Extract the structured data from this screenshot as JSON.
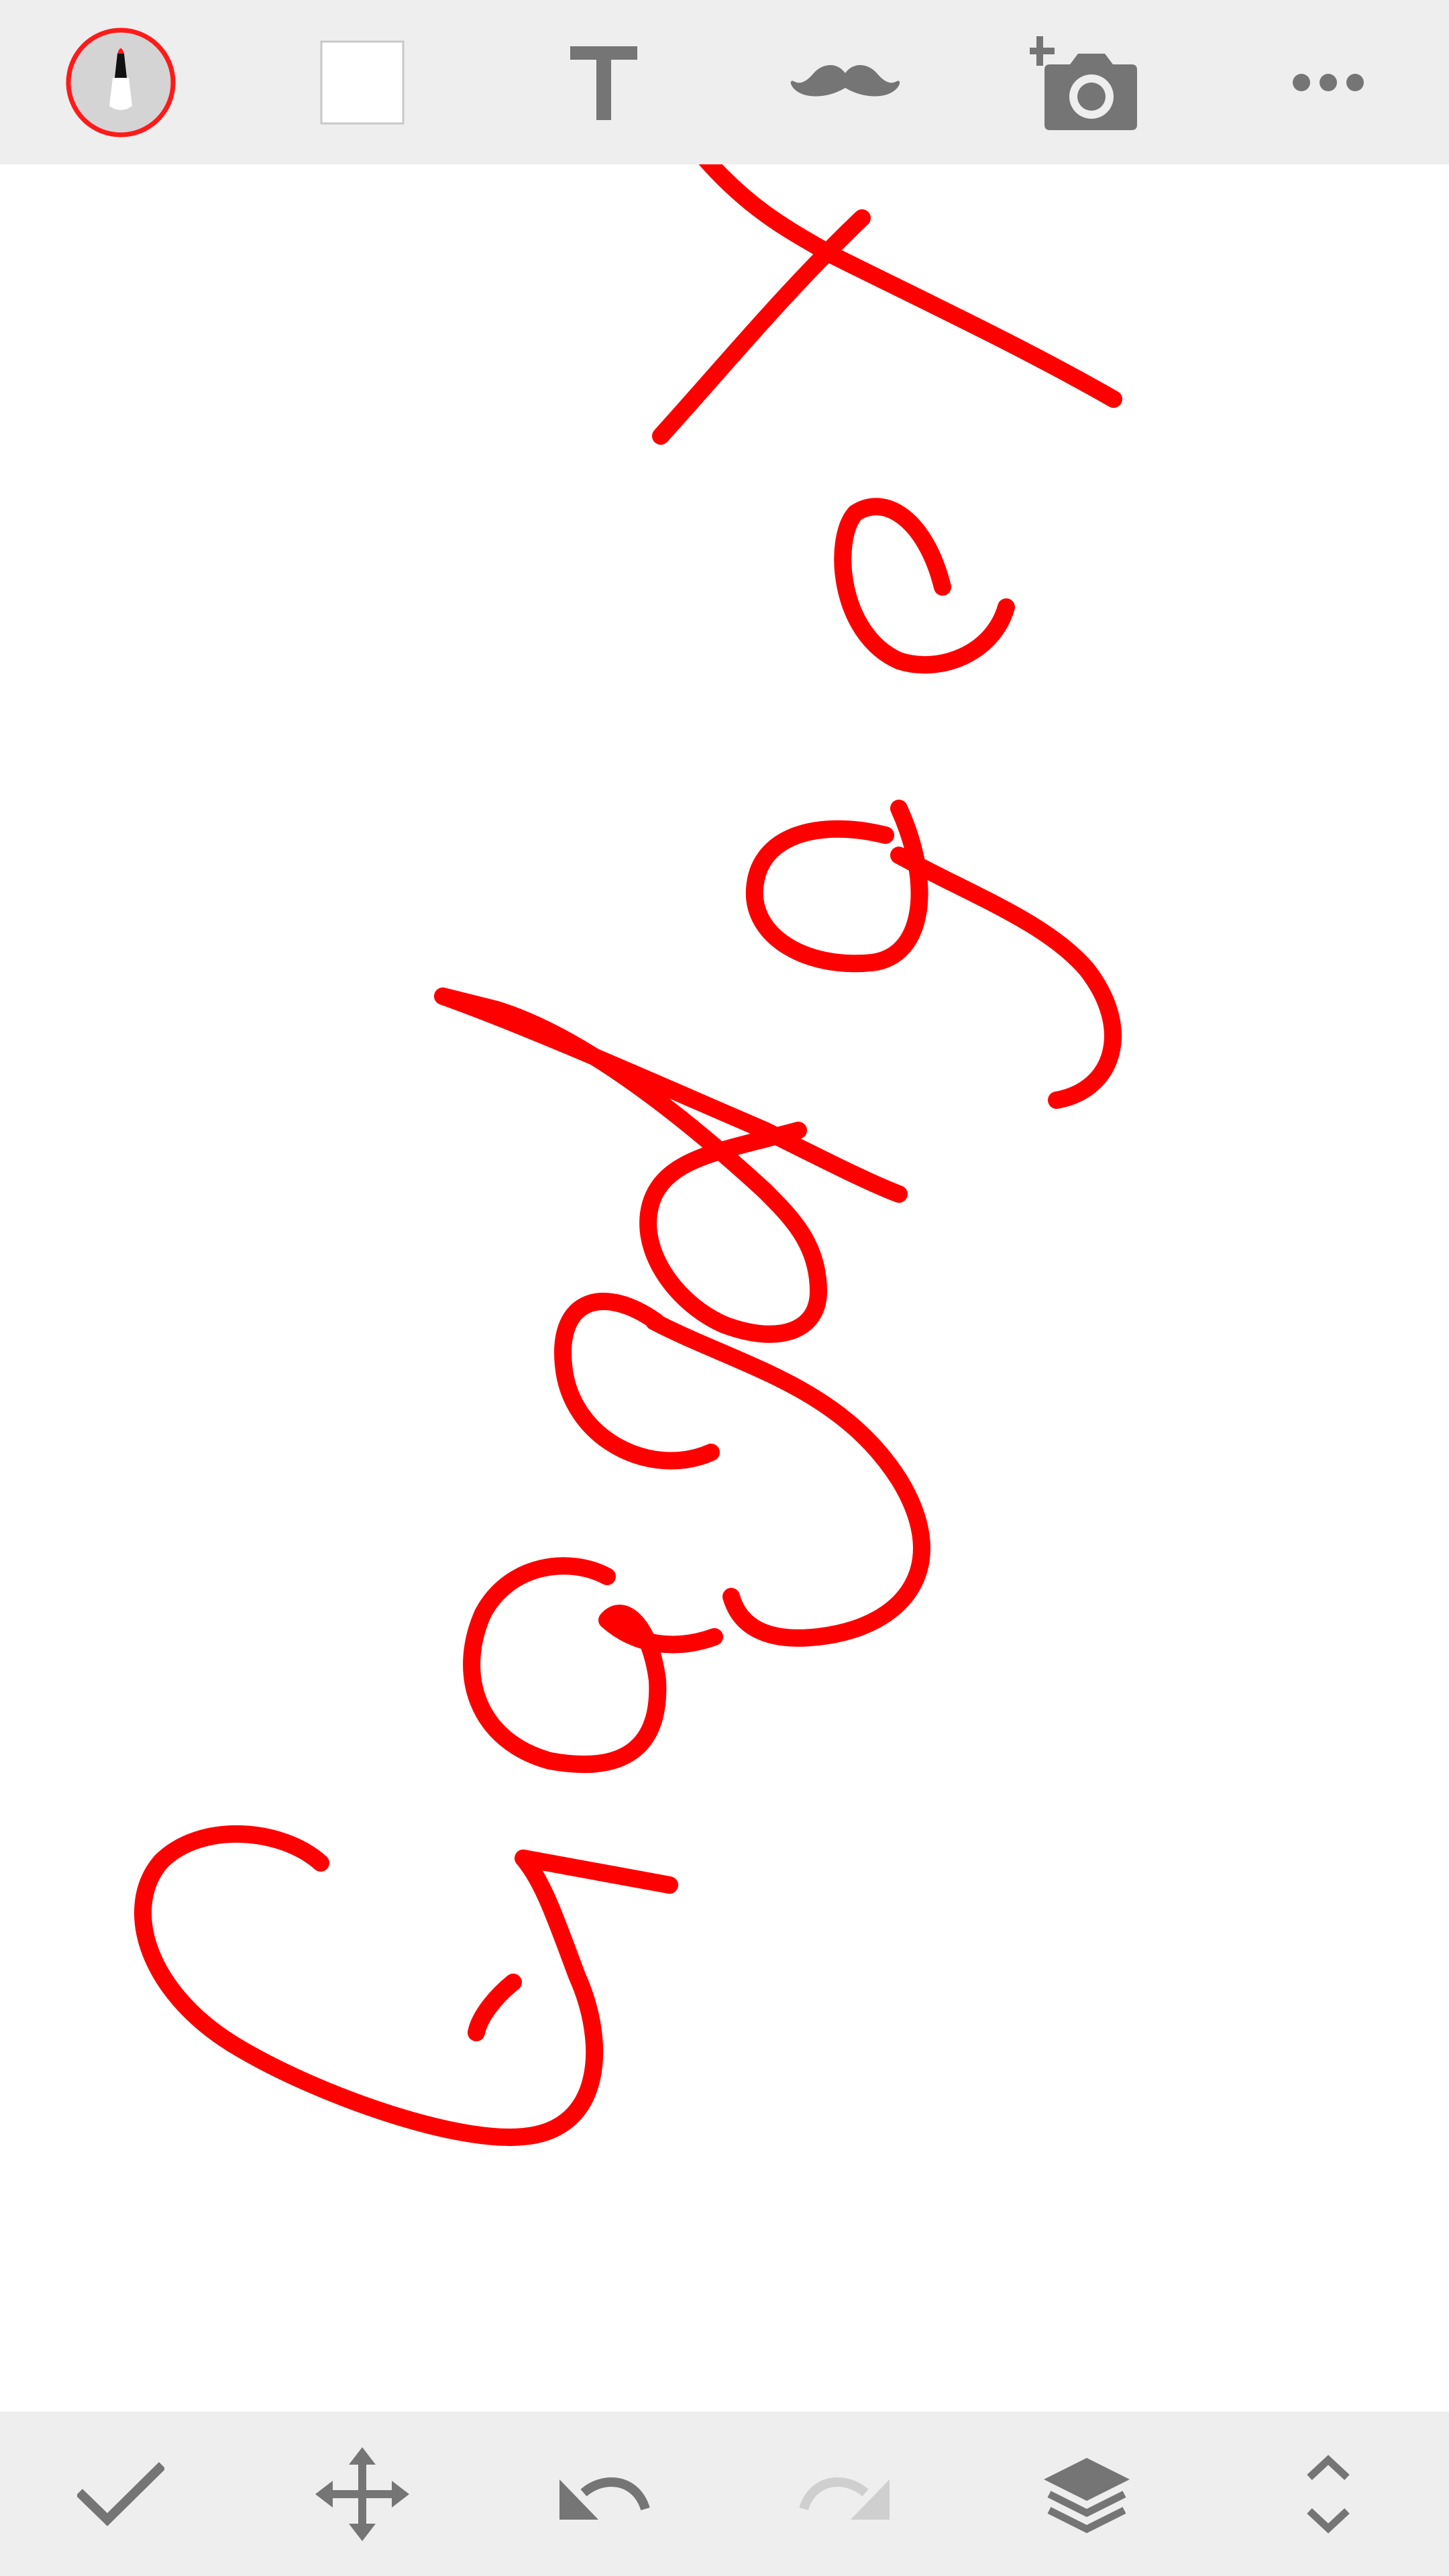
{
  "colors": {
    "toolbar_bg": "#eeeeee",
    "icon_gray": "#757575",
    "icon_disabled": "#cfcfcf",
    "ink": "#ff0000",
    "canvas_bg": "#ffffff"
  },
  "top_toolbar": {
    "tools": [
      {
        "icon": "marker-brush-icon"
      },
      {
        "icon": "color-swatch-icon"
      },
      {
        "icon": "text-tool-icon"
      },
      {
        "icon": "mustache-sticker-icon"
      },
      {
        "icon": "add-photo-camera-icon"
      },
      {
        "icon": "more-options-icon"
      }
    ],
    "selected_tool": "marker-brush-icon",
    "selected_color": "#ffffff"
  },
  "canvas": {
    "handwritten_text": "Gadget",
    "handwriting_rotation_deg": -62,
    "stroke_color": "#ff0000"
  },
  "bottom_toolbar": {
    "actions": [
      {
        "icon": "check-done-icon",
        "enabled": true
      },
      {
        "icon": "move-arrows-icon",
        "enabled": true
      },
      {
        "icon": "undo-icon",
        "enabled": true
      },
      {
        "icon": "redo-icon",
        "enabled": false
      },
      {
        "icon": "layers-icon",
        "enabled": true
      },
      {
        "icon": "expand-collapse-chevrons-icon",
        "enabled": true
      }
    ]
  }
}
